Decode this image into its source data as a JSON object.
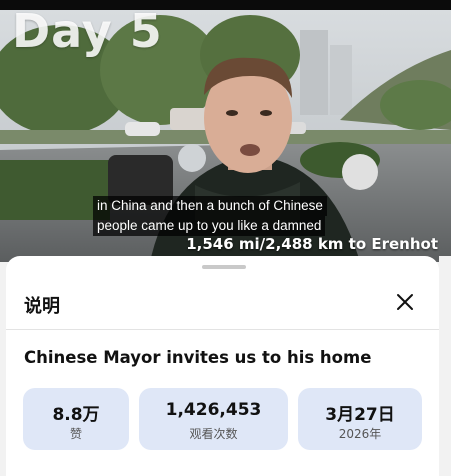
{
  "video": {
    "overlay_title": "Day 5",
    "subtitle_lines": [
      "in China and then a bunch of Chinese",
      "people came up to you like a damned"
    ],
    "distance_caption": "1,546 mi/2,488 km to Erenhot"
  },
  "sheet": {
    "header_title": "说明",
    "close_icon": "close-icon",
    "video_title": "Chinese Mayor invites us to his home",
    "stats": [
      {
        "value": "8.8万",
        "label": "赞"
      },
      {
        "value": "1,426,453",
        "label": "观看次数"
      },
      {
        "value": "3月27日",
        "label": "2026年"
      }
    ]
  },
  "colors": {
    "stat_bg": "#dfe7f7",
    "sheet_bg": "#ffffff",
    "page_bg": "#f2f2f2"
  }
}
